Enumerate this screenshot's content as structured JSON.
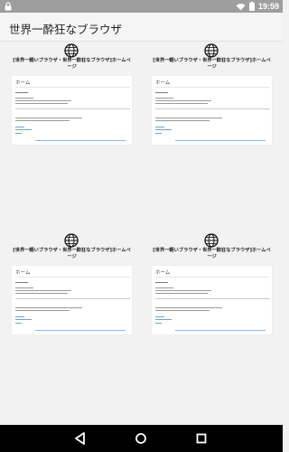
{
  "status": {
    "time": "19:59"
  },
  "app": {
    "title": "世界一酔狂なブラウザ"
  },
  "tiles": [
    {
      "title": "[世界一軽いブラウザ・世界一酔狂なブラウザ]ホームページ",
      "thumb_heading": "ホーム"
    },
    {
      "title": "[世界一軽いブラウザ・世界一酔狂なブラウザ]ホームページ",
      "thumb_heading": "ホーム"
    },
    {
      "title": "[世界一軽いブラウザ・世界一酔狂なブラウザ]ホームページ",
      "thumb_heading": "ホーム"
    },
    {
      "title": "[世界一軽いブラウザ・世界一酔狂なブラウザ]ホームページ",
      "thumb_heading": "ホーム"
    }
  ],
  "nav": {
    "back_icon": "back-triangle-icon",
    "home_icon": "home-circle-icon",
    "recents_icon": "recents-square-icon"
  },
  "colors": {
    "status_bar": "#9e9e9e",
    "nav_bar": "#000000",
    "background": "#f2f2f2",
    "link": "#66a3e0"
  }
}
